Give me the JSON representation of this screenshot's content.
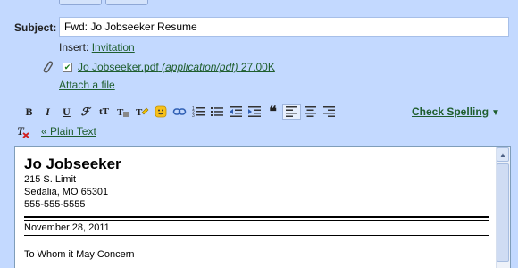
{
  "compose": {
    "subject_label": "Subject:",
    "subject_value": "Fwd: Jo Jobseeker Resume",
    "insert_label": "Insert:",
    "insert_invitation": "Invitation",
    "attachment_name": "Jo Jobseeker.pdf",
    "attachment_type": "(application/pdf)",
    "attachment_size": "27.00K",
    "attach_file": "Attach a file"
  },
  "toolbar": {
    "bold": "B",
    "italic": "I",
    "underline": "U",
    "check_spelling": "Check Spelling",
    "plain_text": "« Plain Text"
  },
  "document": {
    "name": "Jo Jobseeker",
    "address1": "215 S. Limit",
    "address2": "Sedalia, MO 65301",
    "phone": "555-555-5555",
    "date": "November 28, 2011",
    "greeting": "To Whom it May Concern"
  },
  "colors": {
    "background": "#c3d9ff",
    "link": "#1f5e2e"
  }
}
